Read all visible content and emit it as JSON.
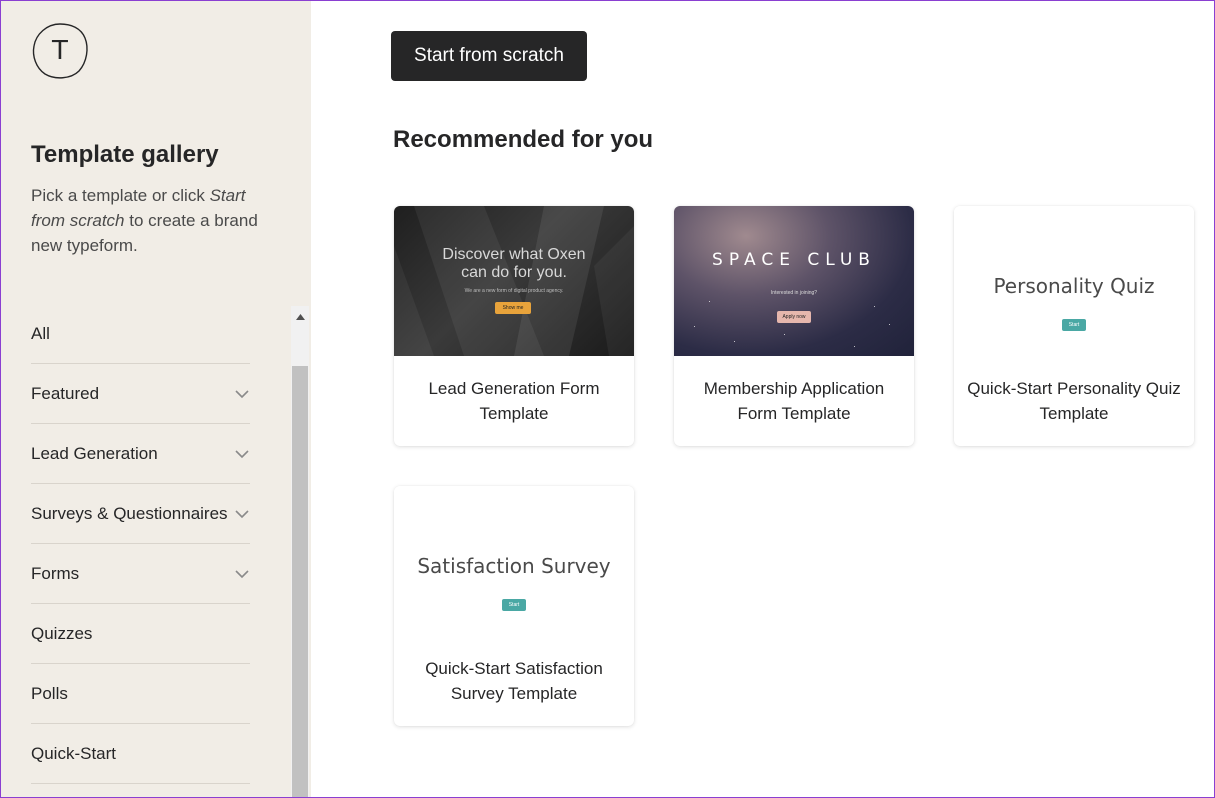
{
  "logo": {
    "letter": "T"
  },
  "sidebar": {
    "title": "Template gallery",
    "desc_1": "Pick a template or click ",
    "desc_em": "Start from scratch",
    "desc_2": " to create a brand new typeform.",
    "categories": [
      {
        "label": "All",
        "expandable": false
      },
      {
        "label": "Featured",
        "expandable": true
      },
      {
        "label": "Lead Generation",
        "expandable": true
      },
      {
        "label": "Surveys & Questionnaires",
        "expandable": true
      },
      {
        "label": "Forms",
        "expandable": true
      },
      {
        "label": "Quizzes",
        "expandable": false
      },
      {
        "label": "Polls",
        "expandable": false
      },
      {
        "label": "Quick-Start",
        "expandable": false
      }
    ]
  },
  "main": {
    "start_button": "Start from scratch",
    "heading": "Recommended for you",
    "cards": [
      {
        "label": "Lead Generation Form Template",
        "thumb_title": "Discover what Oxen can do for you.",
        "thumb_sub": "We are a new form of digital product agency.",
        "thumb_button": "Show me"
      },
      {
        "label": "Membership Application Form Template",
        "thumb_title": "SPACE CLUB",
        "thumb_sub": "Interested in joining?",
        "thumb_button": "Apply now"
      },
      {
        "label": "Quick-Start Personality Quiz Template",
        "thumb_title": "Personality Quiz",
        "thumb_button": "Start"
      },
      {
        "label": "Quick-Start Satisfaction Survey Template",
        "thumb_title": "Satisfaction Survey",
        "thumb_button": "Start"
      }
    ]
  },
  "colors": {
    "sidebar_bg": "#f1ede6",
    "button_dark": "#262627",
    "teal": "#4aa8a4",
    "orange": "#e8a33b",
    "pink": "#e6b7ad"
  }
}
